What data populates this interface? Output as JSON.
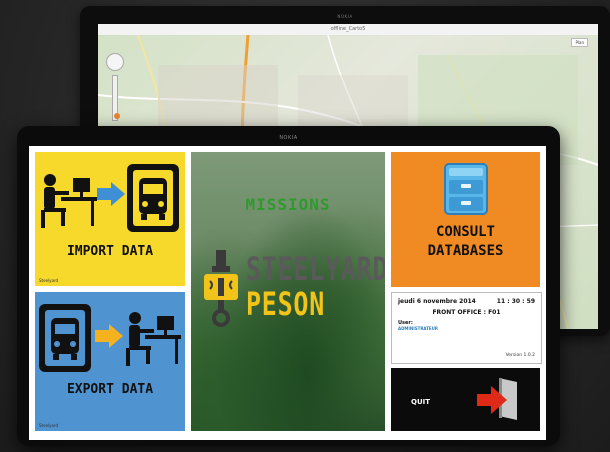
{
  "back_device": {
    "brand": "NOKIA",
    "map_title": "offline_Carto5",
    "map_type": "Plan"
  },
  "front_device": {
    "brand": "NOKIA"
  },
  "tiles": {
    "import": {
      "label": "IMPORT DATA",
      "note": "Steelyard",
      "bg": "#f6d92a"
    },
    "export": {
      "label": "EXPORT DATA",
      "note": "Steelyard",
      "bg": "#4f93d0"
    },
    "center": {
      "heading": "MISSIONS",
      "title_line1": "STEELYARD",
      "title_line2": "PESON"
    },
    "consult": {
      "label_line1": "CONSULT",
      "label_line2": "DATABASES",
      "bg": "#f08a22"
    },
    "info": {
      "date": "jeudi 6 novembre 2014",
      "time": "11 : 30 : 59",
      "office": "FRONT OFFICE : F01",
      "user_label": "User:",
      "user_value": "ADMINISTRATEUR",
      "version": "Version 1.0.2"
    },
    "quit": {
      "label": "QUIT",
      "bg": "#0b0b0b"
    }
  },
  "colors": {
    "accent_green": "#2e9a2e",
    "accent_yellow": "#f2c41a",
    "arrow_red": "#e02a18",
    "arrow_blue": "#3e8fd6",
    "arrow_orange": "#f6b21e"
  }
}
